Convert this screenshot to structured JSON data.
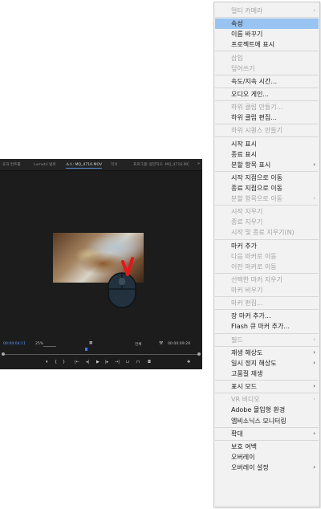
{
  "monitor": {
    "tabs": [
      "효과 컨트롤",
      "Lumetri 범위",
      "소스: MQ_4716.MOV",
      "믹서",
      "프로그램: 몸만하오 ·MQ_4716.MC"
    ],
    "active_tab": 2,
    "more": "»",
    "timecode_left": "00:00:04:11",
    "zoom": "25%",
    "quality": "전체",
    "timecode_right": "00:00:09:28",
    "playhead_fraction": 0.42
  },
  "menu": {
    "items": [
      {
        "label": "멀티 카메라",
        "disabled": true,
        "arrow": true
      },
      {
        "sep": true
      },
      {
        "label": "속성",
        "highlight": true
      },
      {
        "label": "이름 바꾸기"
      },
      {
        "label": "프로젝트에 표시"
      },
      {
        "sep": true
      },
      {
        "label": "삽입",
        "disabled": true
      },
      {
        "label": "덮어쓰기",
        "disabled": true
      },
      {
        "sep": true
      },
      {
        "label": "속도/지속 시간..."
      },
      {
        "sep": true
      },
      {
        "label": "오디오 게인..."
      },
      {
        "sep": true
      },
      {
        "label": "하위 클립 만들기...",
        "disabled": true
      },
      {
        "label": "하위 클립 편집..."
      },
      {
        "sep": true
      },
      {
        "label": "하위 시퀀스 만들기",
        "disabled": true
      },
      {
        "sep": true
      },
      {
        "label": "시작 표시"
      },
      {
        "label": "종료 표시"
      },
      {
        "label": "분할 항목 표시",
        "arrow": true
      },
      {
        "sep": true
      },
      {
        "label": "시작 지점으로 이동"
      },
      {
        "label": "종료 지점으로 이동"
      },
      {
        "label": "분할 항목으로 이동",
        "disabled": true,
        "arrow": true
      },
      {
        "sep": true
      },
      {
        "label": "시작 지우기",
        "disabled": true
      },
      {
        "label": "종료 지우기",
        "disabled": true
      },
      {
        "label": "시작 및 종료 지우기(N)",
        "disabled": true
      },
      {
        "sep": true
      },
      {
        "label": "마커 추가"
      },
      {
        "label": "다음 마커로 이동",
        "disabled": true
      },
      {
        "label": "이전 마커로 이동",
        "disabled": true
      },
      {
        "sep": true
      },
      {
        "label": "선택한 마커 지우기",
        "disabled": true
      },
      {
        "label": "마커 비우기",
        "disabled": true
      },
      {
        "sep": true
      },
      {
        "label": "마커 편집...",
        "disabled": true
      },
      {
        "sep": true
      },
      {
        "label": "장 마커 추가..."
      },
      {
        "label": "Flash 큐 마커 추가..."
      },
      {
        "sep": true
      },
      {
        "label": "필드",
        "disabled": true,
        "arrow": true
      },
      {
        "sep": true
      },
      {
        "label": "재생 해상도",
        "arrow": true
      },
      {
        "label": "일시 정지 해상도",
        "arrow": true
      },
      {
        "label": "고품질 재생"
      },
      {
        "sep": true
      },
      {
        "label": "표시 모드",
        "arrow": true
      },
      {
        "sep": true
      },
      {
        "label": "VR 비디오",
        "disabled": true,
        "arrow": true
      },
      {
        "label": "Adobe 몰입형 환경"
      },
      {
        "label": "엠비소닉스 모니터링"
      },
      {
        "sep": true
      },
      {
        "label": "확대",
        "arrow": true
      },
      {
        "sep": true
      },
      {
        "label": "보호 여백"
      },
      {
        "label": "오버레이"
      },
      {
        "label": "오버레이 설정",
        "arrow": true
      }
    ]
  }
}
